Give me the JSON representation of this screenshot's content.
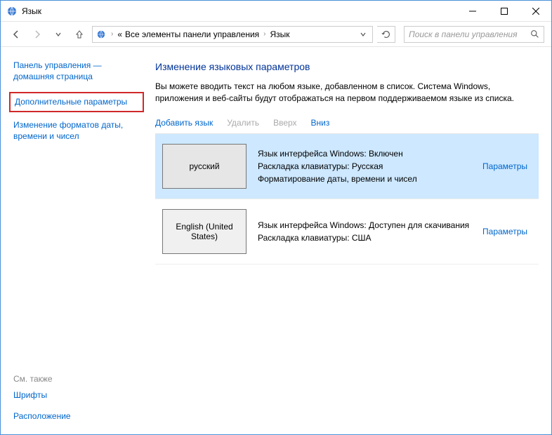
{
  "window": {
    "title": "Язык"
  },
  "breadcrumb": {
    "root_prefix": "«",
    "root": "Все элементы панели управления",
    "current": "Язык"
  },
  "search": {
    "placeholder": "Поиск в панели управления"
  },
  "sidebar": {
    "home": "Панель управления — домашняя страница",
    "advanced": "Дополнительные параметры",
    "formats": "Изменение форматов даты, времени и чисел",
    "seealso_hdr": "См. также",
    "fonts": "Шрифты",
    "location": "Расположение"
  },
  "main": {
    "heading": "Изменение языковых параметров",
    "description": "Вы можете вводить текст на любом языке, добавленном в список. Система Windows, приложения и веб-сайты будут отображаться на первом поддерживаемом языке из списка."
  },
  "toolbar": {
    "add": "Добавить язык",
    "remove": "Удалить",
    "up": "Вверх",
    "down": "Вниз"
  },
  "languages": [
    {
      "name": "русский",
      "line1": "Язык интерфейса Windows: Включен",
      "line2": "Раскладка клавиатуры: Русская",
      "line3": "Форматирование даты, времени и чисел",
      "options": "Параметры"
    },
    {
      "name": "English (United States)",
      "line1": "Язык интерфейса Windows: Доступен для скачивания",
      "line2": "Раскладка клавиатуры: США",
      "line3": "",
      "options": "Параметры"
    }
  ]
}
